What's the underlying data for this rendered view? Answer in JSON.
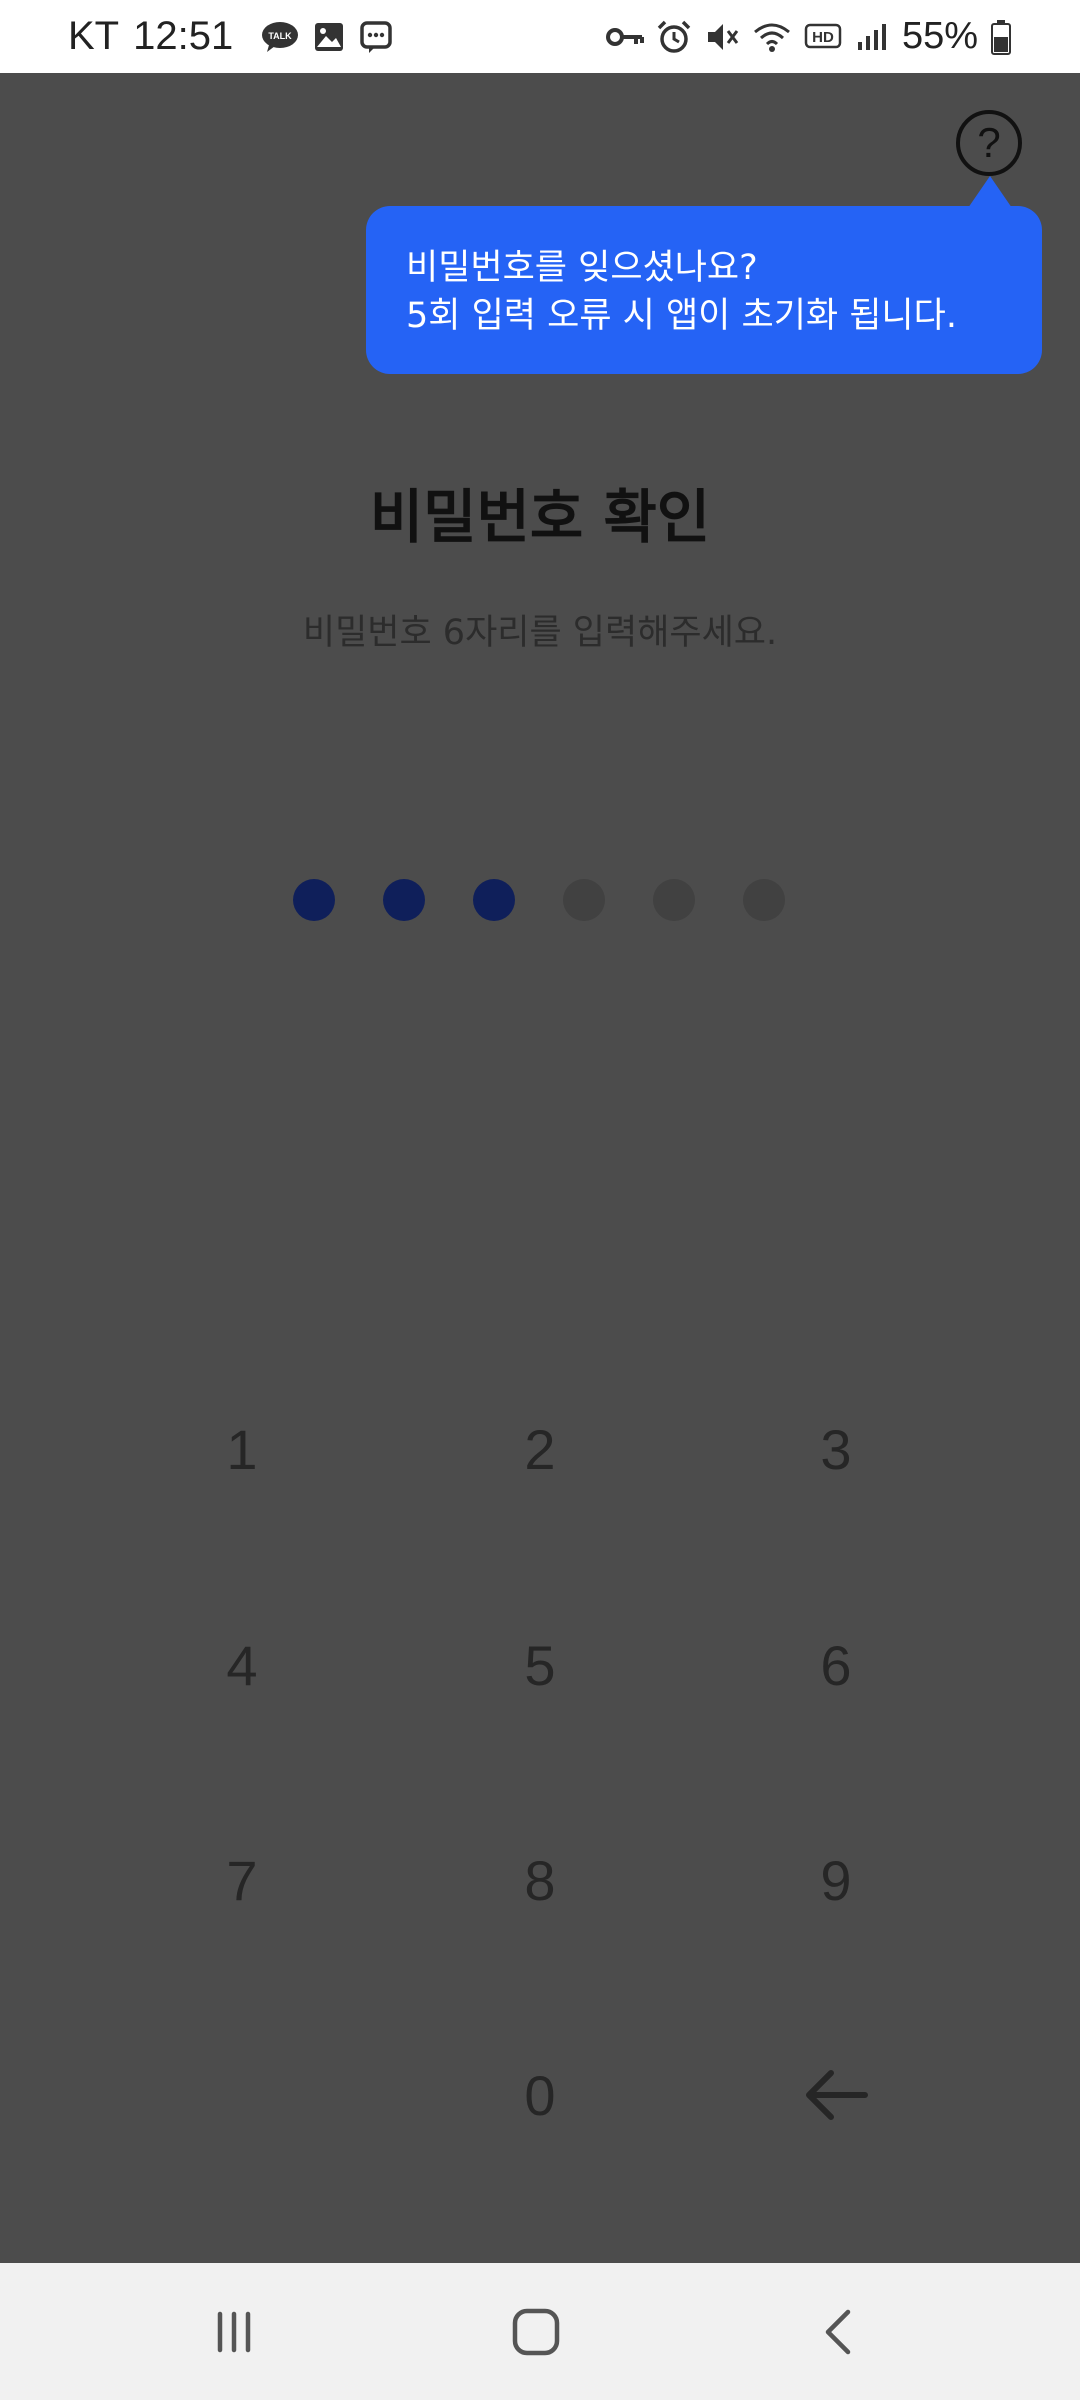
{
  "status_bar": {
    "carrier": "KT",
    "time": "12:51",
    "battery": "55%",
    "left_icons": [
      "talk-icon",
      "gallery-icon",
      "message-icon"
    ],
    "right_icons": [
      "key-icon",
      "alarm-icon",
      "mute-icon",
      "wifi-icon",
      "hd-icon",
      "signal-icon",
      "battery-icon"
    ]
  },
  "help": {
    "icon": "?",
    "tooltip_line1": "비밀번호를 잊으셨나요?",
    "tooltip_line2": "5회 입력 오류 시 앱이 초기화 됩니다."
  },
  "page": {
    "title": "비밀번호 확인",
    "subtitle": "비밀번호 6자리를 입력해주세요."
  },
  "pin": {
    "length": 6,
    "filled": 3,
    "filled_color": "#0f1f5a",
    "empty_color": "#414141"
  },
  "keypad": {
    "keys": [
      "1",
      "2",
      "3",
      "4",
      "5",
      "6",
      "7",
      "8",
      "9",
      "",
      "0",
      "backspace"
    ]
  },
  "nav_bar": {
    "buttons": [
      "recent-apps-icon",
      "home-icon",
      "back-icon"
    ]
  },
  "colors": {
    "overlay": "#4c4c4c",
    "tooltip_bg": "#2563f5",
    "status_bar_bg": "#ffffff",
    "nav_bar_bg": "#f1f1f1"
  }
}
